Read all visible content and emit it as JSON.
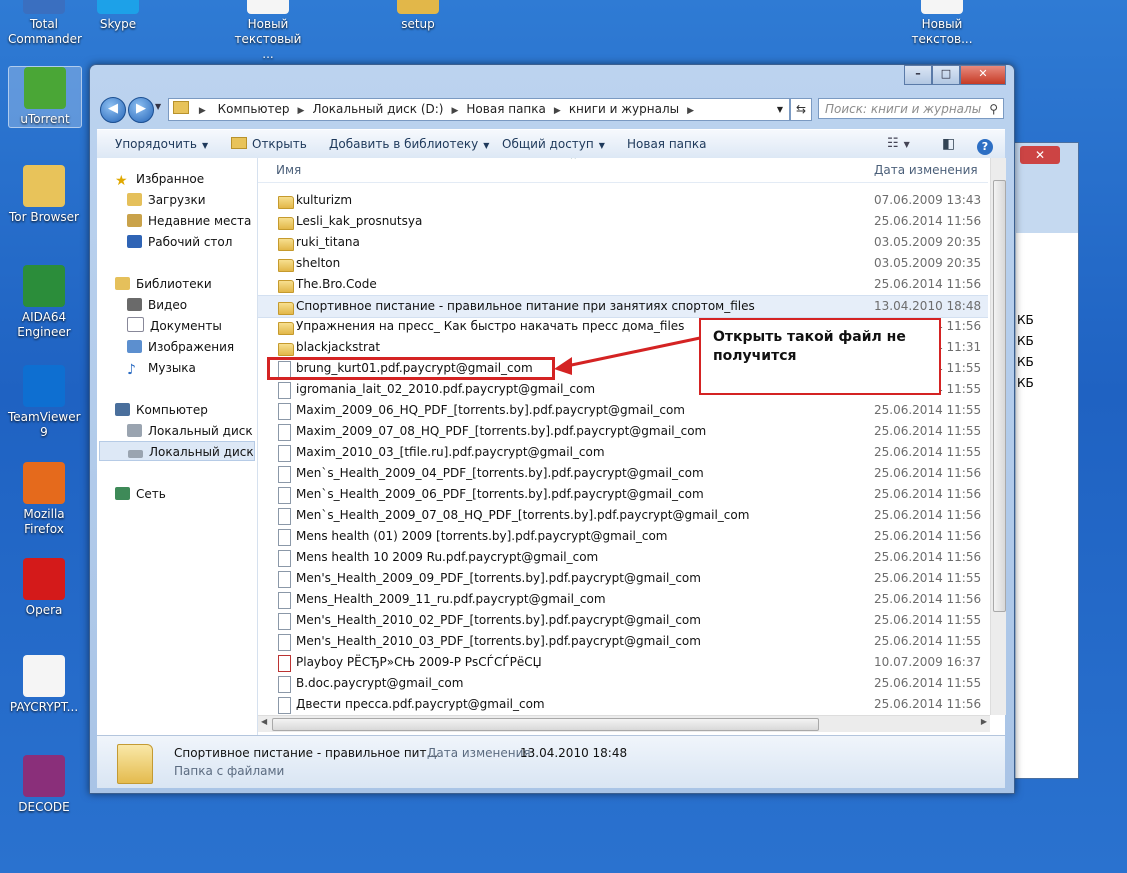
{
  "desktop": {
    "icons": [
      {
        "label": "Total\nCommander",
        "icon": "total-commander-icon"
      },
      {
        "label": "Skype",
        "icon": "skype-icon"
      },
      {
        "label": "Новый\nтекстовый ...",
        "icon": "text-file-icon"
      },
      {
        "label": "setup",
        "icon": "setup-icon"
      },
      {
        "label": "Новый\nтекстов...",
        "icon": "text-file-icon"
      },
      {
        "label": "uTorrent",
        "icon": "utorrent-icon"
      },
      {
        "label": "Tor Browser",
        "icon": "tor-browser-icon"
      },
      {
        "label": "AIDA64\nEngineer",
        "icon": "aida64-icon"
      },
      {
        "label": "TeamViewer\n9",
        "icon": "teamviewer-icon"
      },
      {
        "label": "Mozilla\nFirefox",
        "icon": "firefox-icon"
      },
      {
        "label": "Opera",
        "icon": "opera-icon"
      },
      {
        "label": "PAYCRYPT...",
        "icon": "text-file-icon"
      },
      {
        "label": "DECODE",
        "icon": "winrar-icon"
      }
    ]
  },
  "window": {
    "controls": {
      "minimize": "–",
      "maximize": "□",
      "close": "✕"
    },
    "breadcrumb": [
      "Компьютер",
      "Локальный диск (D:)",
      "Новая папка",
      "книги и журналы"
    ],
    "search_placeholder": "Поиск: книги и журналы",
    "toolbar": {
      "organize": "Упорядочить",
      "open": "Открыть",
      "add_library": "Добавить в библиотеку",
      "share": "Общий доступ",
      "new_folder": "Новая папка"
    },
    "nav": {
      "favorites": "Избранное",
      "downloads": "Загрузки",
      "recent": "Недавние места",
      "desktop": "Рабочий стол",
      "libraries": "Библиотеки",
      "video": "Видео",
      "documents": "Документы",
      "pictures": "Изображения",
      "music": "Музыка",
      "computer": "Компьютер",
      "disk_c": "Локальный диск (C",
      "disk_d": "Локальный диск (D",
      "network": "Сеть"
    },
    "columns": {
      "name": "Имя",
      "date": "Дата изменения"
    },
    "files": [
      {
        "name": "kulturizm",
        "date": "07.06.2009 13:43",
        "type": "folder"
      },
      {
        "name": "Lesli_kak_prosnutsya",
        "date": "25.06.2014 11:56",
        "type": "folder"
      },
      {
        "name": "ruki_titana",
        "date": "03.05.2009 20:35",
        "type": "folder"
      },
      {
        "name": "shelton",
        "date": "03.05.2009 20:35",
        "type": "folder"
      },
      {
        "name": "The.Bro.Code",
        "date": "25.06.2014 11:56",
        "type": "folder"
      },
      {
        "name": "Спортивное пистание - правильное питание при занятиях спортом_files",
        "date": "13.04.2010 18:48",
        "type": "folder"
      },
      {
        "name": "Упражнения на пресс_ Как быстро накачать пресс дома_files",
        "date": "25.06.2014 11:56",
        "type": "folder"
      },
      {
        "name": "blackjackstrat",
        "date": "25.06.2014 11:31",
        "type": "folder"
      },
      {
        "name": "brung_kurt01.pdf.paycrypt@gmail_com",
        "date": "25.06.2014 11:55",
        "type": "doc"
      },
      {
        "name": "igromania_lait_02_2010.pdf.paycrypt@gmail_com",
        "date": "25.06.2014 11:55",
        "type": "doc"
      },
      {
        "name": "Maxim_2009_06_HQ_PDF_[torrents.by].pdf.paycrypt@gmail_com",
        "date": "25.06.2014 11:55",
        "type": "doc"
      },
      {
        "name": "Maxim_2009_07_08_HQ_PDF_[torrents.by].pdf.paycrypt@gmail_com",
        "date": "25.06.2014 11:55",
        "type": "doc"
      },
      {
        "name": "Maxim_2010_03_[tfile.ru].pdf.paycrypt@gmail_com",
        "date": "25.06.2014 11:55",
        "type": "doc"
      },
      {
        "name": "Men`s_Health_2009_04_PDF_[torrents.by].pdf.paycrypt@gmail_com",
        "date": "25.06.2014 11:56",
        "type": "doc"
      },
      {
        "name": "Men`s_Health_2009_06_PDF_[torrents.by].pdf.paycrypt@gmail_com",
        "date": "25.06.2014 11:56",
        "type": "doc"
      },
      {
        "name": "Men`s_Health_2009_07_08_HQ_PDF_[torrents.by].pdf.paycrypt@gmail_com",
        "date": "25.06.2014 11:56",
        "type": "doc"
      },
      {
        "name": "Mens health  (01) 2009 [torrents.by].pdf.paycrypt@gmail_com",
        "date": "25.06.2014 11:56",
        "type": "doc"
      },
      {
        "name": "Mens health 10 2009 Ru.pdf.paycrypt@gmail_com",
        "date": "25.06.2014 11:56",
        "type": "doc"
      },
      {
        "name": "Men's_Health_2009_09_PDF_[torrents.by].pdf.paycrypt@gmail_com",
        "date": "25.06.2014 11:55",
        "type": "doc"
      },
      {
        "name": "Mens_Health_2009_11_ru.pdf.paycrypt@gmail_com",
        "date": "25.06.2014 11:56",
        "type": "doc"
      },
      {
        "name": "Men's_Health_2010_02_PDF_[torrents.by].pdf.paycrypt@gmail_com",
        "date": "25.06.2014 11:55",
        "type": "doc"
      },
      {
        "name": "Men's_Health_2010_03_PDF_[torrents.by].pdf.paycrypt@gmail_com",
        "date": "25.06.2014 11:55",
        "type": "doc"
      },
      {
        "name": "Playboy РЁСЂР»СЊ 2009-Р РѕСЃСЃРёСЏ",
        "date": "10.07.2009 16:37",
        "type": "pdf"
      },
      {
        "name": "B.doc.paycrypt@gmail_com",
        "date": "25.06.2014 11:55",
        "type": "doc"
      },
      {
        "name": "Двести пресса.pdf.paycrypt@gmail_com",
        "date": "25.06.2014 11:56",
        "type": "doc"
      }
    ],
    "details": {
      "name": "Спортивное пистание - правильное пит...",
      "date_label": "Дата изменения:",
      "date_value": "13.04.2010 18:48",
      "type": "Папка с файлами"
    }
  },
  "back_window": {
    "kb": [
      "КБ",
      "КБ",
      "КБ",
      "КБ"
    ]
  },
  "annotation": {
    "text": "Открыть такой файл не получится"
  }
}
